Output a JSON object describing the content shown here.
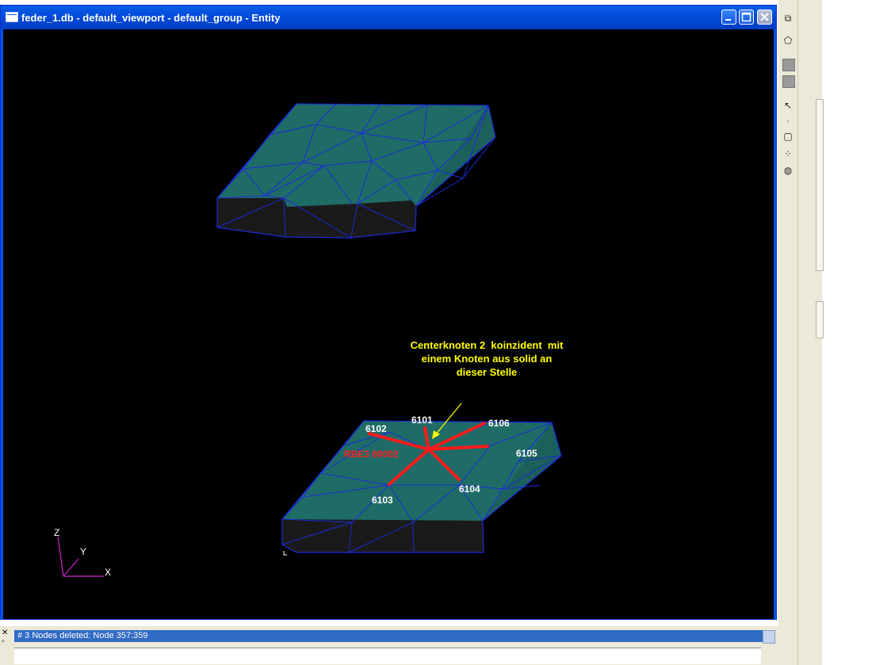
{
  "window": {
    "title": "feder_1.db - default_viewport - default_group - Entity"
  },
  "annotation": {
    "line1": "Centerknoten 2  koinzident  mit",
    "line2": "einem Knoten aus solid an",
    "line3": "dieser Stelle",
    "rbe_label": "RBE3 80002"
  },
  "nodes": [
    "6101",
    "6102",
    "6106",
    "6105",
    "6104",
    "6103"
  ],
  "axes": {
    "z": "Z",
    "y": "Y",
    "x": "X"
  },
  "status": {
    "message": "# 3 Nodes deleted: Node 357:359"
  },
  "colors": {
    "viewport_bg": "#000000",
    "solid_top": "#1f6b66",
    "solid_side": "#1a1a1a",
    "mesh": "#1b2bd8",
    "rbe": "#ff1a1a",
    "annotation": "#ffff00",
    "node_label": "#ffffff"
  }
}
